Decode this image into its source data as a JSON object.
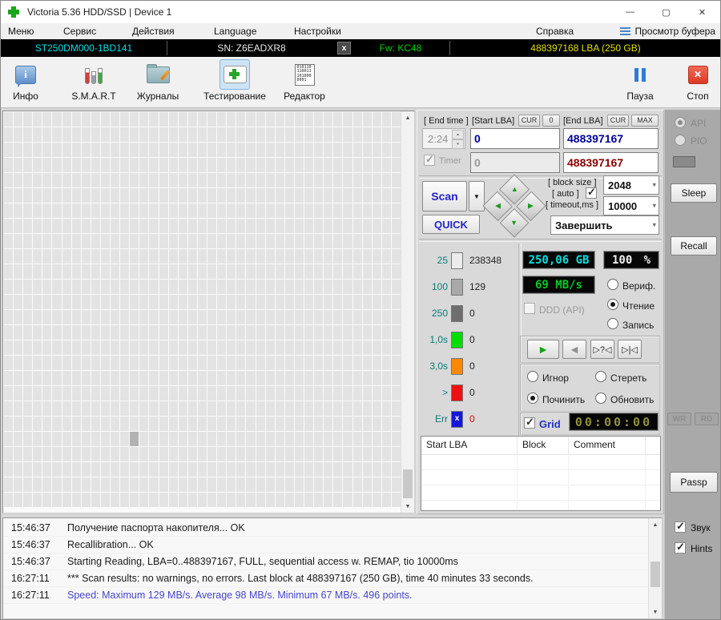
{
  "window": {
    "title": "Victoria 5.36 HDD/SSD | Device 1",
    "minimize": "—",
    "maximize": "▢",
    "close": "✕"
  },
  "menu": {
    "items": [
      "Меню",
      "Сервис",
      "Действия",
      "Language",
      "Настройки",
      "Справка"
    ],
    "buffer_view": "Просмотр буфера"
  },
  "device_bar": {
    "model": "ST250DM000-1BD141",
    "serial": "SN: Z6EADXR8",
    "x_button": "x",
    "firmware": "Fw: KC48",
    "capacity": "488397168 LBA (250 GB)"
  },
  "toolbar": {
    "info": "Инфо",
    "smart": "S.M.A.R.T",
    "journals": "Журналы",
    "testing": "Тестирование",
    "editor": "Редактор",
    "pause": "Пауза",
    "stop": "Стоп",
    "editor_icon_lines": [
      "010110",
      "110011",
      "101000",
      "0001"
    ]
  },
  "test_setup": {
    "end_time_label": "[ End time ]",
    "end_time": "2:24",
    "start_lba_label": "[Start LBA]",
    "cur": "CUR",
    "zero": "0",
    "max": "MAX",
    "end_lba_label": "[End LBA]",
    "start_lba": "0",
    "end_lba": "488397167",
    "timer_label": "Timer",
    "timer_from": "0",
    "timer_to": "488397167",
    "scan": "Scan",
    "quick": "QUICK",
    "block_size_label": "[ block size ]",
    "auto_label": "[ auto ]",
    "block_size": "2048",
    "timeout_label": "[ timeout,ms ]",
    "timeout": "10000",
    "on_end_action": "Завершить"
  },
  "legend": [
    {
      "label": "25",
      "value": "238348",
      "color": "#ececec"
    },
    {
      "label": "100",
      "value": "129",
      "color": "#a9a9a9"
    },
    {
      "label": "250",
      "value": "0",
      "color": "#6e6e6e"
    },
    {
      "label": "1,0s",
      "value": "0",
      "color": "#00dd00"
    },
    {
      "label": "3,0s",
      "value": "0",
      "color": "#ff8800"
    },
    {
      "label": ">",
      "value": "0",
      "color": "#ee1111"
    },
    {
      "label": "Err",
      "value": "0",
      "color": "#1515dd",
      "glyph": "x"
    }
  ],
  "displays": {
    "capacity": "250,06 GB",
    "percent": "100",
    "percent_sign": "%",
    "speed": "69 MB/s",
    "elapsed": "00:00:00"
  },
  "mode": {
    "ddd": "DDD (API)",
    "verify": "Вериф.",
    "read": "Чтение",
    "write": "Запись"
  },
  "playback": {
    "play": "►",
    "back": "◄",
    "scan_question": "▷?◁",
    "scan_end": "▷|◁"
  },
  "defects": {
    "ignore": "Игнор",
    "erase": "Стереть",
    "remap": "Починить",
    "restore": "Обновить"
  },
  "grid_toggle": {
    "label": "Grid"
  },
  "defect_table": {
    "headers": [
      "Start LBA",
      "Block",
      "Comment"
    ],
    "empty_rows": 4
  },
  "sidebar": {
    "api": "API",
    "pio": "PIO",
    "sleep": "Sleep",
    "recall": "Recall",
    "wr": "WR",
    "rd": "RD",
    "passp": "Passp",
    "sound": "Звук",
    "hints": "Hints"
  },
  "log": {
    "lines": [
      {
        "time": "15:46:37",
        "text": "Получение паспорта накопителя... OK",
        "style": "normal"
      },
      {
        "time": "15:46:37",
        "text": "Recallibration... OK",
        "style": "normal"
      },
      {
        "time": "15:46:37",
        "text": "Starting Reading, LBA=0..488397167, FULL, sequential access w. REMAP, tio 10000ms",
        "style": "normal"
      },
      {
        "time": "16:27:11",
        "text": "*** Scan results: no warnings, no errors. Last block at 488397167 (250 GB), time 40 minutes 33 seconds.",
        "style": "normal"
      },
      {
        "time": "16:27:11",
        "text": "Speed: Maximum 129 MB/s. Average 98 MB/s. Minimum 67 MB/s. 496 points.",
        "style": "accent"
      }
    ]
  },
  "scan_map": {
    "columns": 41,
    "rows": 26,
    "cell_color": "#e3e3e3",
    "special": {
      "row": 21,
      "col": 13,
      "color": "#b2b2b2"
    }
  },
  "icons": {
    "chevron_down": "▾",
    "spin_up": "▴",
    "spin_down": "▾",
    "scroll_up": "▲",
    "scroll_down": "▼",
    "tri_up": "▲",
    "tri_right": "▶",
    "tri_left": "◀",
    "tri_down": "▼",
    "dropdown_arrow": "▼"
  },
  "colors": {
    "model_cyan": "#00e0e0",
    "fw_green": "#00d200",
    "capacity_yellow": "#e0e000",
    "lcd_cyan": "#00e0e0",
    "lcd_green": "#00cc22",
    "accent_blue": "#2323cc",
    "log_accent": "#4646cc",
    "lba_navy": "#00009b",
    "lba_darkred": "#8b0000"
  }
}
